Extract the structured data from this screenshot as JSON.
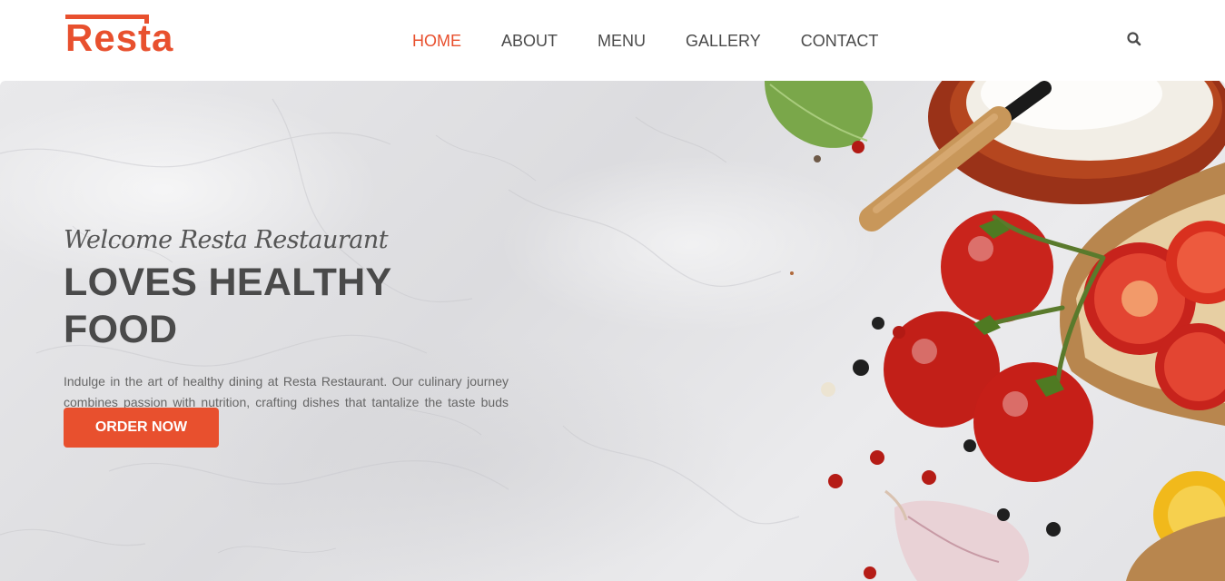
{
  "brand": {
    "name": "Resta",
    "color": "#e8502e"
  },
  "nav": {
    "items": [
      {
        "label": "HOME",
        "active": true
      },
      {
        "label": "ABOUT",
        "active": false
      },
      {
        "label": "MENU",
        "active": false
      },
      {
        "label": "GALLERY",
        "active": false
      },
      {
        "label": "CONTACT",
        "active": false
      }
    ],
    "search_icon": "search-icon"
  },
  "hero": {
    "tagline": "Welcome Resta Restaurant",
    "headline": "LOVES HEALTHY FOOD",
    "description": "Indulge in the art of healthy dining at Resta Restaurant. Our culinary journey combines passion with nutrition, crafting dishes that tantalize the taste buds while nourishing the body.",
    "cta_label": "ORDER NOW",
    "image": "marble-tabletop-with-tomatoes-basil-garlic-cheese-bowl"
  },
  "colors": {
    "accent": "#e8502e",
    "text_dark": "#4a4a4a",
    "text_body": "#666666"
  }
}
